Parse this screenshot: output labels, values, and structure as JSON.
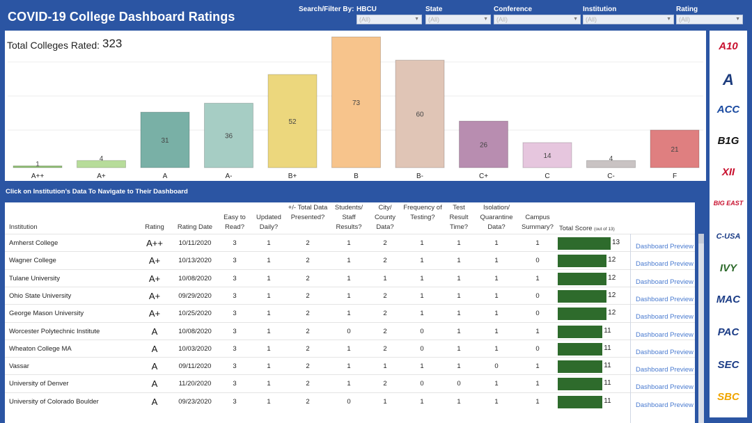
{
  "header": {
    "title": "COVID-19 College Dashboard Ratings",
    "filter_lead": "Search/Filter By:",
    "filters": [
      {
        "label": "HBCU",
        "value": "(All)"
      },
      {
        "label": "State",
        "value": "(All)"
      },
      {
        "label": "Conference",
        "value": "(All)"
      },
      {
        "label": "Institution",
        "value": "(All)"
      },
      {
        "label": "Rating",
        "value": "(All)"
      }
    ]
  },
  "summary": {
    "total_label": "Total Colleges Rated:",
    "total_value": "323"
  },
  "chart_data": {
    "type": "bar",
    "categories": [
      "A++",
      "A+",
      "A",
      "A-",
      "B+",
      "B",
      "B-",
      "C+",
      "C",
      "C-",
      "F"
    ],
    "values": [
      1,
      4,
      31,
      36,
      52,
      73,
      60,
      26,
      14,
      4,
      21
    ],
    "colors": [
      "#8fbf73",
      "#b7dc9a",
      "#79b0a6",
      "#a6cdc4",
      "#ecd77d",
      "#f7c48c",
      "#e0c5b6",
      "#b88db0",
      "#e6c6de",
      "#c9c3c3",
      "#df7f80"
    ],
    "ylim": [
      0,
      73
    ],
    "grid": true
  },
  "nav_hint": "Click on Institution’s Data To Navigate to Their Dashboard",
  "table": {
    "headers": [
      "Institution",
      "Rating",
      "Rating Date",
      "Easy to Read?",
      "Updated Daily?",
      "+/- Total Data Presented?",
      "Students/ Staff Results?",
      "City/ County Data?",
      "Frequency of Testing?",
      "Test Result Time?",
      "Isolation/ Quarantine Data?",
      "Campus Summary?"
    ],
    "score_header": "Total Score",
    "score_suffix": "(out of 13)",
    "score_max": 13,
    "link_label": "Dashboard Preview",
    "rows": [
      {
        "institution": "Amherst College",
        "rating": "A++",
        "date": "10/11/2020",
        "vals": [
          "3",
          "1",
          "2",
          "1",
          "2",
          "1",
          "1",
          "1",
          "1"
        ],
        "score": "13"
      },
      {
        "institution": "Wagner College",
        "rating": "A+",
        "date": "10/13/2020",
        "vals": [
          "3",
          "1",
          "2",
          "1",
          "2",
          "1",
          "1",
          "1",
          "0"
        ],
        "score": "12"
      },
      {
        "institution": "Tulane University",
        "rating": "A+",
        "date": "10/08/2020",
        "vals": [
          "3",
          "1",
          "2",
          "1",
          "1",
          "1",
          "1",
          "1",
          "1"
        ],
        "score": "12"
      },
      {
        "institution": "Ohio State University",
        "rating": "A+",
        "date": "09/29/2020",
        "vals": [
          "3",
          "1",
          "2",
          "1",
          "2",
          "1",
          "1",
          "1",
          "0"
        ],
        "score": "12"
      },
      {
        "institution": "George Mason University",
        "rating": "A+",
        "date": "10/25/2020",
        "vals": [
          "3",
          "1",
          "2",
          "1",
          "2",
          "1",
          "1",
          "1",
          "0"
        ],
        "score": "12"
      },
      {
        "institution": "Worcester Polytechnic Institute",
        "rating": "A",
        "date": "10/08/2020",
        "vals": [
          "3",
          "1",
          "2",
          "0",
          "2",
          "0",
          "1",
          "1",
          "1"
        ],
        "score": "11"
      },
      {
        "institution": "Wheaton College MA",
        "rating": "A",
        "date": "10/03/2020",
        "vals": [
          "3",
          "1",
          "2",
          "1",
          "2",
          "0",
          "1",
          "1",
          "0"
        ],
        "score": "11"
      },
      {
        "institution": "Vassar",
        "rating": "A",
        "date": "09/11/2020",
        "vals": [
          "3",
          "1",
          "2",
          "1",
          "1",
          "1",
          "1",
          "0",
          "1"
        ],
        "score": "11"
      },
      {
        "institution": "University of Denver",
        "rating": "A",
        "date": "11/20/2020",
        "vals": [
          "3",
          "1",
          "2",
          "1",
          "2",
          "0",
          "0",
          "1",
          "1"
        ],
        "score": "11"
      },
      {
        "institution": "University of Colorado Boulder",
        "rating": "A",
        "date": "09/23/2020",
        "vals": [
          "3",
          "1",
          "2",
          "0",
          "1",
          "1",
          "1",
          "1",
          "1"
        ],
        "score": "11"
      }
    ]
  },
  "conference_logos": [
    {
      "name": "a10-logo",
      "text": "A10",
      "color": "#c8102e"
    },
    {
      "name": "aac-logo",
      "text": "A",
      "color": "#1d3c7d"
    },
    {
      "name": "acc-logo",
      "text": "ACC",
      "color": "#1a4aa0"
    },
    {
      "name": "big-ten-logo",
      "text": "B1G",
      "color": "#111111"
    },
    {
      "name": "big-12-logo",
      "text": "XII",
      "color": "#c8102e"
    },
    {
      "name": "big-east-logo",
      "text": "BIG EAST",
      "color": "#c8102e"
    },
    {
      "name": "c-usa-logo",
      "text": "C-USA",
      "color": "#1b3c86"
    },
    {
      "name": "ivy-league-logo",
      "text": "IVY",
      "color": "#2e6b2c"
    },
    {
      "name": "mac-logo",
      "text": "MAC",
      "color": "#1b3c86"
    },
    {
      "name": "pac-12-logo",
      "text": "PAC",
      "color": "#1b3c86"
    },
    {
      "name": "sec-logo",
      "text": "SEC",
      "color": "#1b3c86"
    },
    {
      "name": "sun-belt-logo",
      "text": "SBC",
      "color": "#f0a500"
    }
  ]
}
